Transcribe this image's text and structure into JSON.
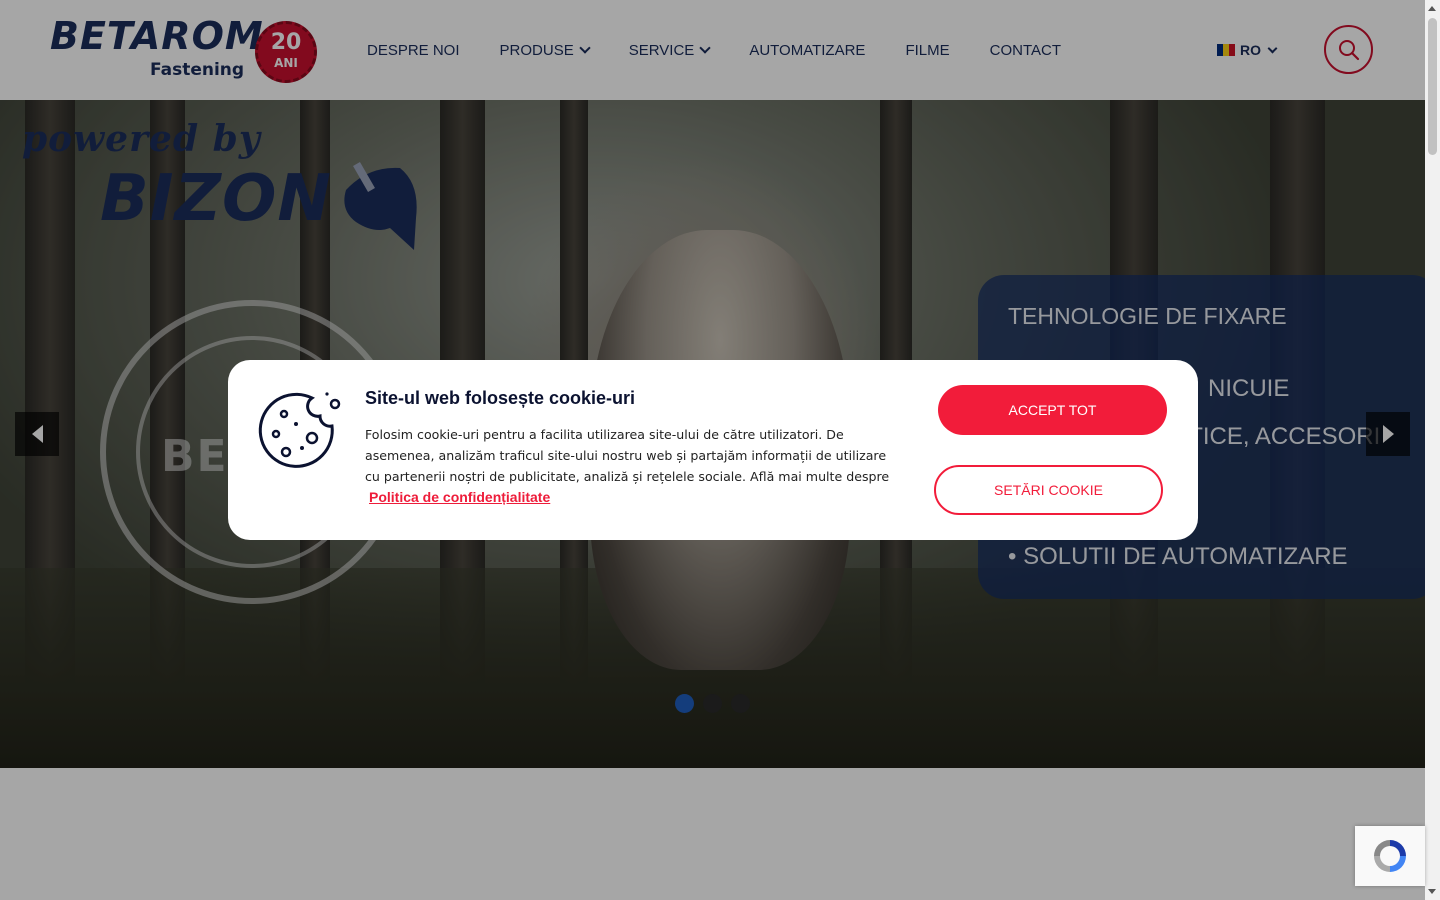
{
  "brand": {
    "logo_main": "BETAROM",
    "logo_sub": "Fastening",
    "anniversary_number": "20",
    "anniversary_word": "ANI"
  },
  "nav": {
    "items": [
      {
        "label": "DESPRE NOI",
        "has_dropdown": false
      },
      {
        "label": "PRODUSE",
        "has_dropdown": true
      },
      {
        "label": "SERVICE",
        "has_dropdown": true
      },
      {
        "label": "AUTOMATIZARE",
        "has_dropdown": false
      },
      {
        "label": "FILME",
        "has_dropdown": false
      },
      {
        "label": "CONTACT",
        "has_dropdown": false
      }
    ],
    "language": "RO"
  },
  "hero": {
    "powered_by": "powered by",
    "partner": "BIZON",
    "stamp_text": "BE",
    "panel_title": "TEHNOLOGIE DE FIXARE",
    "panel_items": [
      "NICUIE",
      "ATICE, ACCESORI",
      "• SOLUTII DE AUTOMATIZARE"
    ],
    "slides_total": 3,
    "active_slide": 1
  },
  "cookie": {
    "title": "Site-ul web folosește cookie-uri",
    "text": "Folosim cookie-uri pentru a facilita utilizarea site-ului de către utilizatori. De asemenea, analizăm traficul site-ului nostru web și partajăm informații de utilizare cu partenerii noștri de publicitate, analiză și rețelele sociale. Află mai multe despre",
    "policy_link": "Politica de confidențialitate",
    "accept_label": "ACCEPT TOT",
    "settings_label": "SETĂRI COOKIE"
  },
  "colors": {
    "brand_navy": "#1b2d5b",
    "accent_red": "#f21c3a",
    "active_dot": "#1f5fbf"
  },
  "icons": [
    "search-icon",
    "chevron-down-icon",
    "romania-flag-icon",
    "cookie-icon",
    "arrow-left-icon",
    "arrow-right-icon",
    "recaptcha-icon"
  ]
}
